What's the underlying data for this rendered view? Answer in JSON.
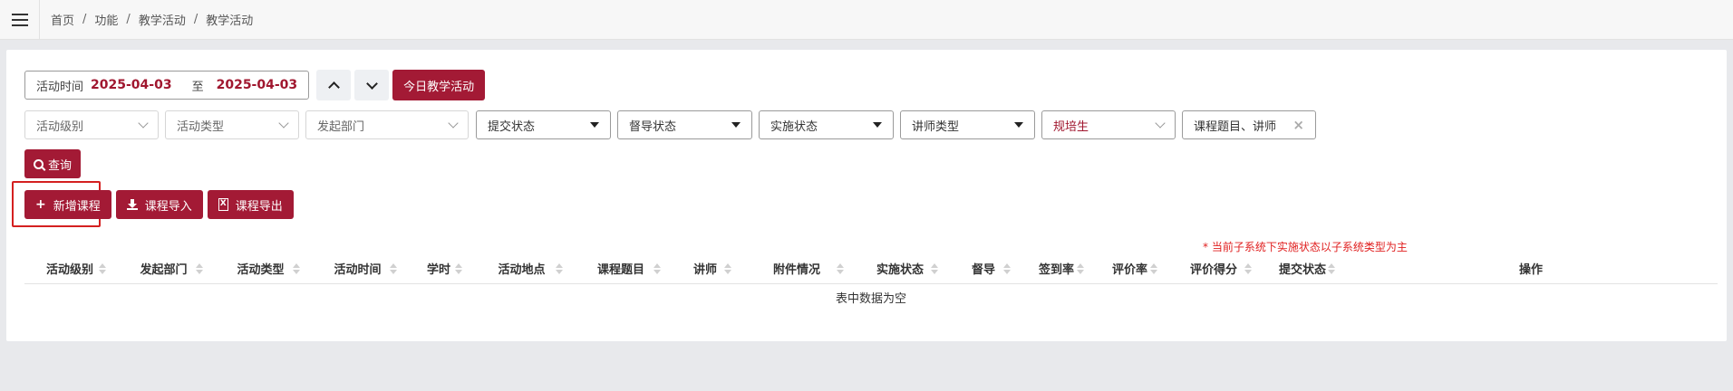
{
  "breadcrumb": [
    "首页",
    "功能",
    "教学活动",
    "教学活动"
  ],
  "date_range": {
    "label": "活动时间",
    "start": "2025-04-03",
    "separator": "至",
    "end": "2025-04-03"
  },
  "today_button": "今日教学活动",
  "filters": {
    "activity_level": "活动级别",
    "activity_type": "活动类型",
    "department": "发起部门",
    "submit_status": "提交状态",
    "supervise_status": "督导状态",
    "implement_status": "实施状态",
    "lecturer_type": "讲师类型",
    "trainee_type": "规培生",
    "keyword": "课程题目、讲师",
    "clear": "×"
  },
  "query_button": "查询",
  "actions": {
    "add_course": "新增课程",
    "import": "课程导入",
    "export": "课程导出"
  },
  "note": "* 当前子系统下实施状态以子系统类型为主",
  "table": {
    "columns": [
      "活动级别",
      "发起部门",
      "活动类型",
      "活动时间",
      "学时",
      "活动地点",
      "课程题目",
      "讲师",
      "附件情况",
      "实施状态",
      "督导",
      "签到率",
      "评价率",
      "评价得分",
      "提交状态",
      "操作"
    ],
    "empty_text": "表中数据为空"
  },
  "colors": {
    "brand": "#a31a35",
    "accent_text": "#a0172f",
    "note": "#e02020",
    "highlight": "#d42020"
  }
}
